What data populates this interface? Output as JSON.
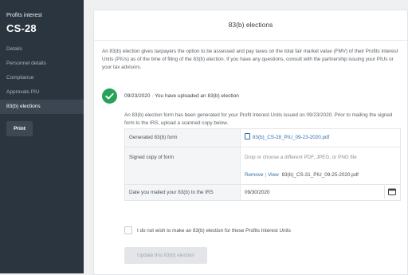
{
  "sidebar": {
    "kicker": "Profits interest",
    "title": "CS-28",
    "items": [
      {
        "label": "Details"
      },
      {
        "label": "Personnel details"
      },
      {
        "label": "Compliance"
      },
      {
        "label": "Approvals PIU"
      },
      {
        "label": "83(b) elections",
        "active": true
      }
    ],
    "print_label": "Print"
  },
  "main": {
    "title": "83(b) elections",
    "intro": "An 83(b) election gives taxpayers the option to be assessed and pay taxes on the total fair market value (FMV) of their Profits Interest Units (PIUs) as of the time of filing of the 83(b) election. If you have any questions, consult with the partnership issuing your PIUs or your tax advisors.",
    "upload_status": "09/23/2020 · You have uploaded an 83(b) election",
    "generated_text": "An 83(b) election form has been generated for your Profit Interest Units issued on 09/23/2020. Prior to mailing the signed form to the IRS, upload a scanned copy below.",
    "form": {
      "generated_label": "Generated 83(b) form",
      "generated_file": "83(b)_CS-28_PIU_09-23-2020.pdf",
      "signed_label": "Signed copy of form",
      "drop_text": "Drop or choose a different PDF, JPEG, or PNG file",
      "remove_label": "Remove",
      "view_label": "View",
      "uploaded_file": "83(b)_CS-31_PIU_09-25-2020.pdf",
      "date_label": "Date you mailed your 83(b) to the IRS",
      "date_value": "09/30/2020"
    },
    "checkbox_label": "I do not wish to make an 83(b) election for these Profits Interest Units",
    "checkbox_checked": false,
    "update_label": "Update this 83(b) election"
  },
  "colors": {
    "sidebar_bg": "#2b3540",
    "success": "#27a25a",
    "link": "#2f6fa8"
  },
  "icons": [
    "check-icon",
    "file-icon",
    "calendar-icon"
  ]
}
